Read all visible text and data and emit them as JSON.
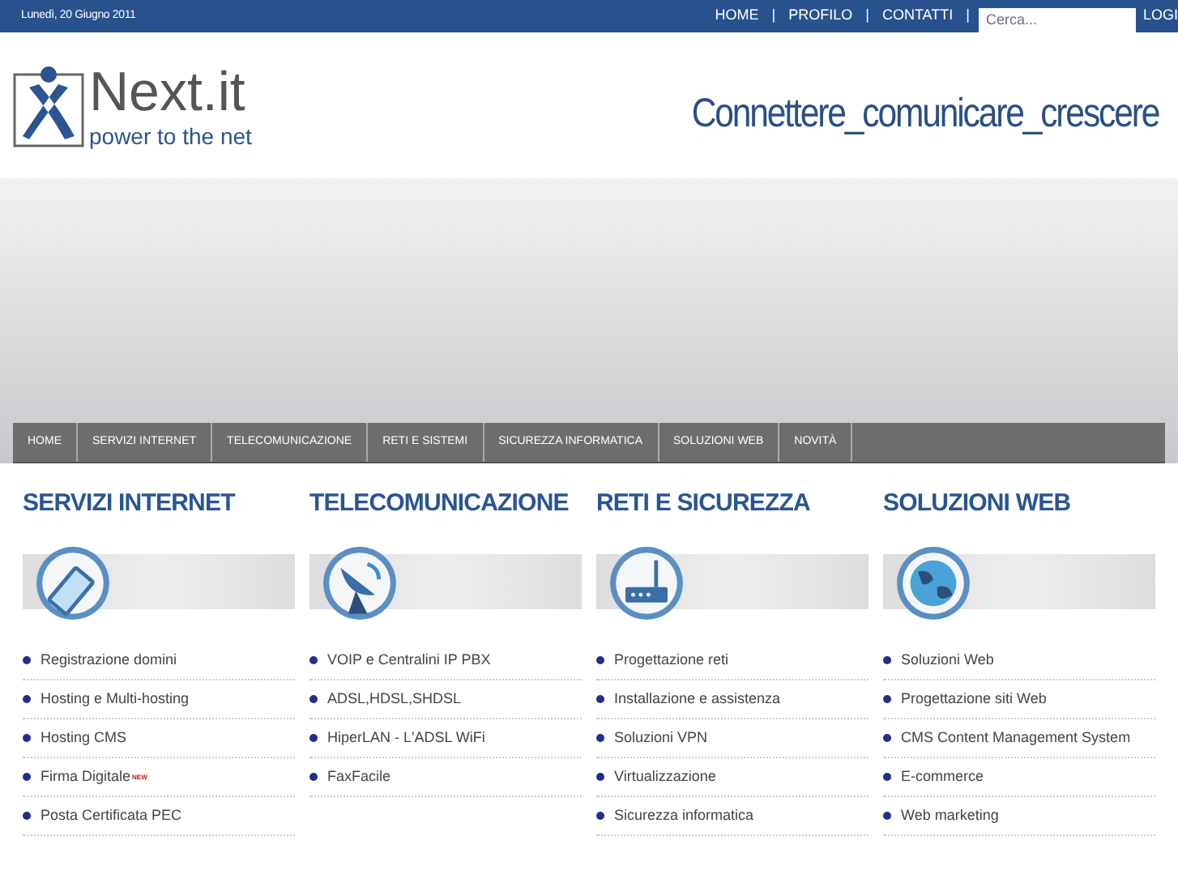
{
  "top_bar": {
    "date": "Lunedì, 20 Giugno 2011",
    "links": [
      "HOME",
      "PROFILO",
      "CONTATTI"
    ],
    "separator": "|",
    "search": {
      "placeholder": "Cerca..."
    },
    "login": "LOGI"
  },
  "header": {
    "logo_name": "Next.it",
    "logo_tagline": "power to the net",
    "slogan": "Connettere_comunicare_crescere"
  },
  "nav": [
    {
      "label": "HOME"
    },
    {
      "label": "SERVIZI INTERNET"
    },
    {
      "label": "TELECOMUNICAZIONE"
    },
    {
      "label": "RETI E SISTEMI"
    },
    {
      "label": "SICUREZZA INFORMATICA"
    },
    {
      "label": "SOLUZIONI WEB"
    },
    {
      "label": "NOVITÀ"
    }
  ],
  "columns": [
    {
      "title": "SERVIZI INTERNET",
      "items": [
        {
          "label": "Registrazione domini"
        },
        {
          "label": "Hosting e Multi-hosting"
        },
        {
          "label": "Hosting CMS"
        },
        {
          "label": "Firma Digitale",
          "badge": "NEW"
        },
        {
          "label": "Posta Certificata PEC"
        }
      ]
    },
    {
      "title": "TELECOMUNICAZIONE",
      "items": [
        {
          "label": "VOIP e Centralini IP PBX"
        },
        {
          "label": "ADSL,HDSL,SHDSL"
        },
        {
          "label": "HiperLAN - L'ADSL WiFi"
        },
        {
          "label": "FaxFacile"
        }
      ]
    },
    {
      "title": "RETI E SICUREZZA",
      "items": [
        {
          "label": "Progettazione reti"
        },
        {
          "label": "Installazione e assistenza"
        },
        {
          "label": "Soluzioni VPN"
        },
        {
          "label": "Virtualizzazione"
        },
        {
          "label": "Sicurezza informatica"
        }
      ]
    },
    {
      "title": "SOLUZIONI WEB",
      "items": [
        {
          "label": "Soluzioni Web"
        },
        {
          "label": "Progettazione siti Web"
        },
        {
          "label": "CMS Content Management System"
        },
        {
          "label": "E-commerce"
        },
        {
          "label": "Web marketing"
        }
      ]
    }
  ]
}
